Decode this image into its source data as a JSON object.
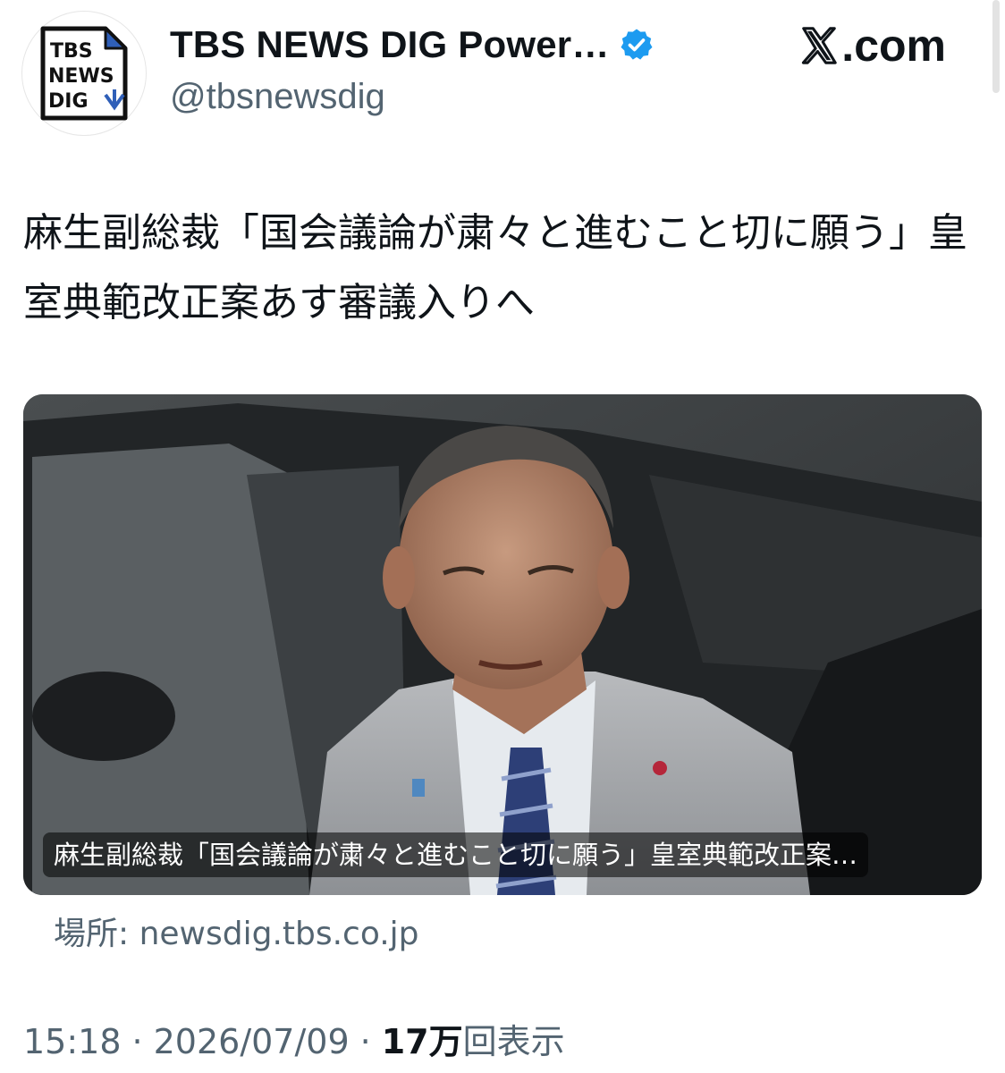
{
  "header": {
    "avatar_text_lines": [
      "TBS",
      "NEWS",
      "DIG"
    ],
    "display_name": "TBS NEWS DIG Power…",
    "handle": "@tbsnewsdig",
    "source_site": ".com",
    "verified_color": "#1d9bf0"
  },
  "tweet": {
    "text": "麻生副総裁「国会議論が粛々と進むこと切に願う」皇室典範改正案あす審議入りへ"
  },
  "card": {
    "title": "麻生副総裁「国会議論が粛々と進むこと切に願う」皇室典範改正案…",
    "domain": "場所: newsdig.tbs.co.jp"
  },
  "meta": {
    "time": "15:18",
    "separator": "·",
    "date": "2026/07/09",
    "views_count": "17万",
    "views_label": "回表示"
  },
  "colors": {
    "text_primary": "#0f1419",
    "text_secondary": "#536471",
    "logo_blue": "#2f5fb8"
  }
}
